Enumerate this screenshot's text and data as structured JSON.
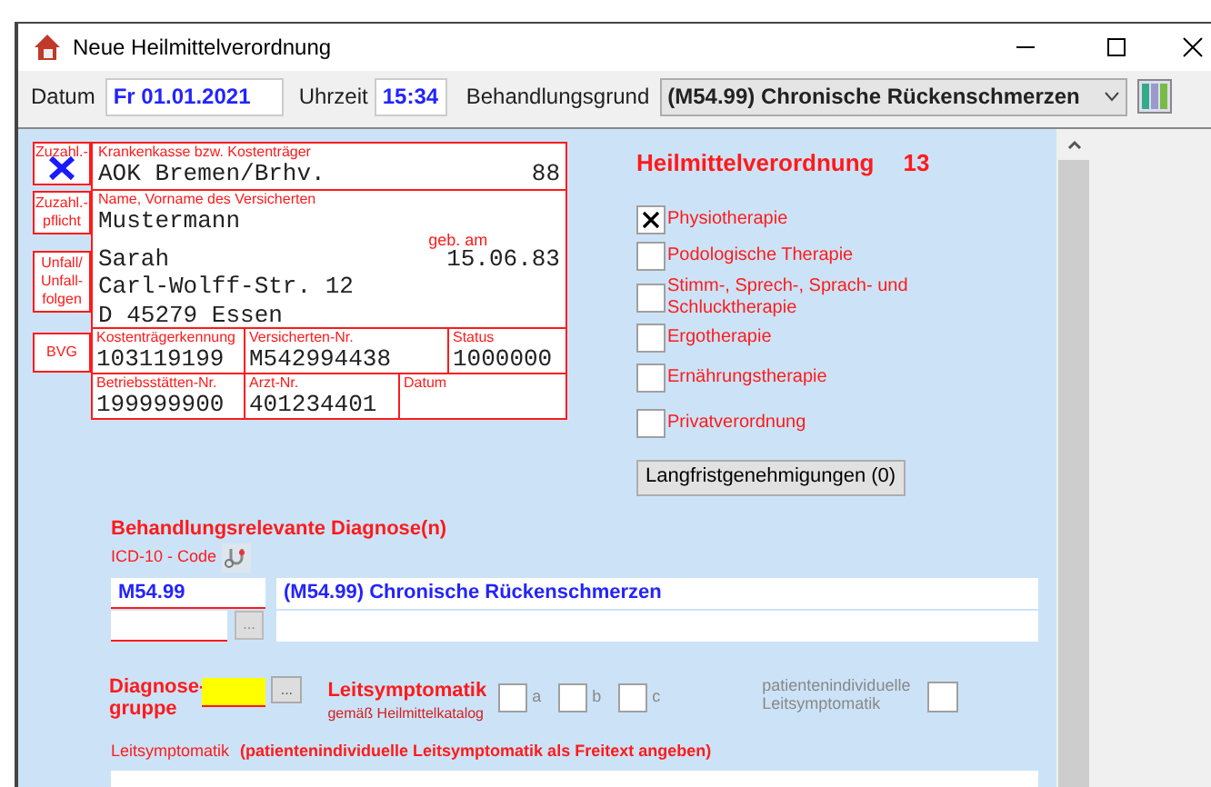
{
  "window": {
    "title": "Neue Heilmittelverordnung"
  },
  "toolbar": {
    "date_label": "Datum",
    "date": "Fr 01.01.2021",
    "time_label": "Uhrzeit",
    "time": "15:34",
    "reason_label": "Behandlungsgrund",
    "reason": "(M54.99) Chronische Rückenschmerzen"
  },
  "card": {
    "side_labels": [
      "Zuzahl.-",
      "Zuzahl.-\npflicht",
      "Unfall/\nUnfall-\nfolgen",
      "BVG"
    ],
    "copay_free_checked": true,
    "insurer_label": "Krankenkasse bzw. Kostenträger",
    "insurer": "AOK Bremen/Brhv.",
    "insurer_code": "88",
    "name_label": "Name, Vorname des Versicherten",
    "surname": "Mustermann",
    "first_name": "Sarah",
    "birth_label": "geb. am",
    "birth_date": "15.06.83",
    "street": "Carl-Wolff-Str. 12",
    "city": "D 45279 Essen",
    "row1": [
      {
        "label": "Kostenträgerkennung",
        "value": "103119199"
      },
      {
        "label": "Versicherten-Nr.",
        "value": "M542994438"
      },
      {
        "label": "Status",
        "value": "1000000"
      }
    ],
    "row2": [
      {
        "label": "Betriebsstätten-Nr.",
        "value": "199999900"
      },
      {
        "label": "Arzt-Nr.",
        "value": "401234401"
      },
      {
        "label": "Datum"
      }
    ]
  },
  "prescription": {
    "heading": "Heilmittelverordnung",
    "number": "13",
    "therapies": [
      {
        "label": "Physiotherapie",
        "checked": true
      },
      {
        "label": "Podologische Therapie",
        "checked": false
      },
      {
        "label": "Stimm-, Sprech-, Sprach- und Schlucktherapie",
        "checked": false
      },
      {
        "label": "Ergotherapie",
        "checked": false
      },
      {
        "label": "Ernährungstherapie",
        "checked": false
      },
      {
        "label": "Privatverordnung",
        "checked": false
      }
    ],
    "button": "Langfristgenehmigungen (0)"
  },
  "diagnosis": {
    "heading": "Behandlungsrelevante Diagnose(n)",
    "icd_label": "ICD-10 - Code",
    "code": "M54.99",
    "description": "(M54.99) Chronische Rückenschmerzen",
    "more_button": "...",
    "group_label": "Diagnose-\ngruppe",
    "group_button": "...",
    "symptoms_heading": "Leitsymptomatik",
    "symptoms_sub": "gemäß Heilmittelkatalog",
    "symptom_options": [
      {
        "label": "a",
        "checked": false
      },
      {
        "label": "b",
        "checked": false
      },
      {
        "label": "c",
        "checked": false
      }
    ],
    "individual_label": "patientenindividuelle\nLeitsymptomatik",
    "individual_checked": false,
    "free_text_label": "Leitsymptomatik",
    "free_text_hint": "(patientenindividuelle Leitsymptomatik als Freitext angeben)"
  }
}
